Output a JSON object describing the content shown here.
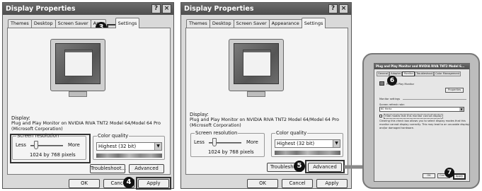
{
  "panel1": {
    "title": "Display Properties",
    "help_glyph": "?",
    "close_glyph": "×",
    "tabs": [
      "Themes",
      "Desktop",
      "Screen Saver",
      "Appe",
      "Settings"
    ],
    "display_label": "Display:",
    "display_line1": "Plug and Play Monitor on NVIDIA RIVA TNT2 Model 64/Model 64 Pro",
    "display_line2": "(Microsoft Corporation)",
    "resolution_label": "Screen resolution",
    "less": "Less",
    "more": "More",
    "resolution_value": "1024 by 768 pixels",
    "color_label": "Color quality",
    "color_value": "Highest (32 bit)",
    "troubleshoot": "Troubleshoot...",
    "advanced": "Advanced",
    "ok": "OK",
    "cancel": "Cancel",
    "apply": "Apply"
  },
  "panel2": {
    "title": "Display Properties",
    "help_glyph": "?",
    "close_glyph": "×",
    "tabs": [
      "Themes",
      "Desktop",
      "Screen Saver",
      "Appearance",
      "Settings"
    ],
    "display_label": "Display:",
    "display_line1": "Plug and Play Monitor on NVIDIA RIVA TNT2 Model 64/Model 64 Pro",
    "display_line2": "(Microsoft Corporation)",
    "resolution_label": "Screen resolution",
    "less": "Less",
    "more": "More",
    "resolution_value": "1024 by 768 pixels",
    "color_label": "Color quality",
    "color_value": "Highest (32 bit)",
    "troubleshoot": "Troubleshoot",
    "advanced": "Advanced",
    "ok": "OK",
    "cancel": "Cancel",
    "apply": "Apply"
  },
  "panel3": {
    "title": "Plug and Play Monitor and NVIDIA RIVA TNT2 Model 6...",
    "tabs": [
      "General",
      "Adapter",
      "Monitor",
      "Troubleshoot",
      "Color Management"
    ],
    "monitor_type": "Plug and Play Monitor",
    "properties": "Properties",
    "monitor_settings": "Monitor settings",
    "refresh_label": "Screen refresh rate:",
    "refresh_value": "60 Hertz",
    "hide_modes": "Hide modes that this monitor cannot display",
    "info1": "Clearing this check box allows you to select display modes that this",
    "info2": "monitor cannot display correctly. This may lead to an unusable display",
    "info3": "and/or damaged hardware.",
    "ok": "OK",
    "cancel": "Can",
    "apply": "Apply"
  },
  "badges": {
    "b3": "3",
    "b4": "4",
    "b5": "5",
    "b6": "6",
    "b7": "7"
  },
  "colors": {
    "titlebar": "#5a5a5a",
    "panel": "#f4f4f4",
    "callout": "#bdbdbd"
  }
}
